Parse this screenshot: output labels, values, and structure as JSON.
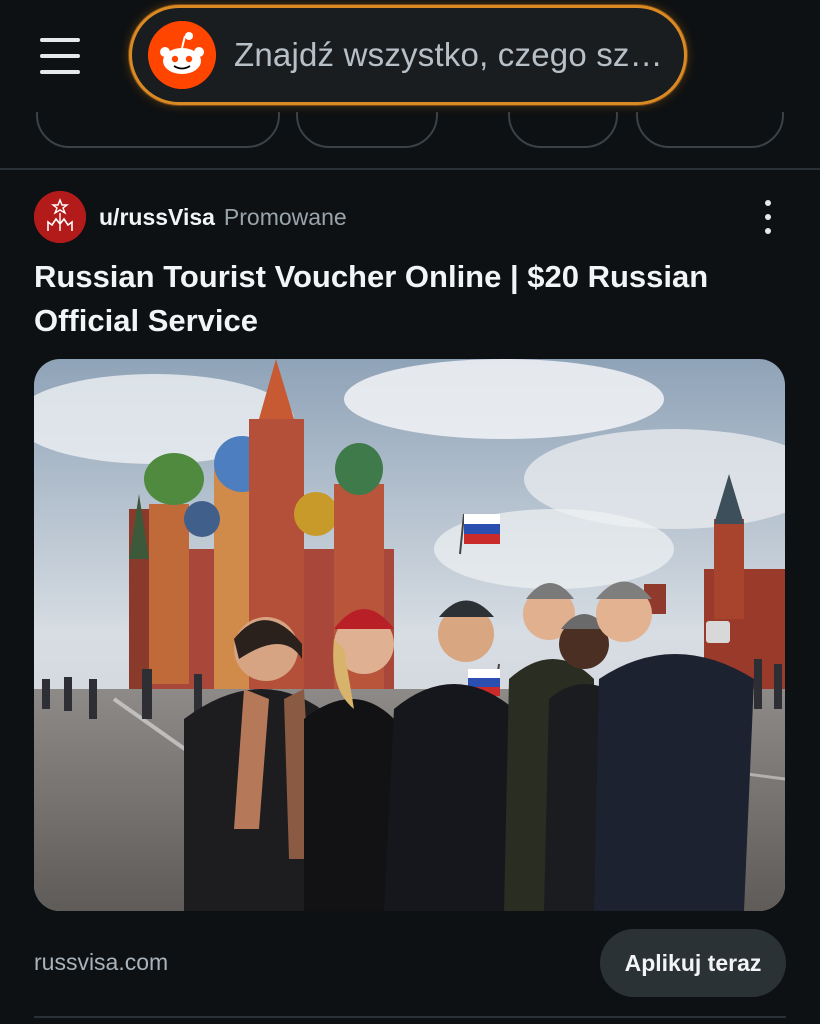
{
  "search": {
    "placeholder": "Znajdź wszystko, czego sz…"
  },
  "icons": {
    "menu": "hamburger-menu-icon",
    "logo": "reddit-snoo-icon",
    "more": "vertical-ellipsis-icon",
    "avatar": "kremlin-tower-icon"
  },
  "post": {
    "author": "u/russVisa",
    "promoted_label": "Promowane",
    "title": "Russian Tourist Voucher Online | $20 Russian Official Service",
    "image_subject": "Tourists taking a selfie on Red Square in front of St. Basil's Cathedral",
    "domain": "russvisa.com",
    "cta_label": "Aplikuj teraz"
  },
  "colors": {
    "background": "#0e1113",
    "accent_orange": "#ff4500",
    "search_border": "#d98a24",
    "avatar_red": "#b31b1b",
    "button_bg": "#2b3236"
  }
}
